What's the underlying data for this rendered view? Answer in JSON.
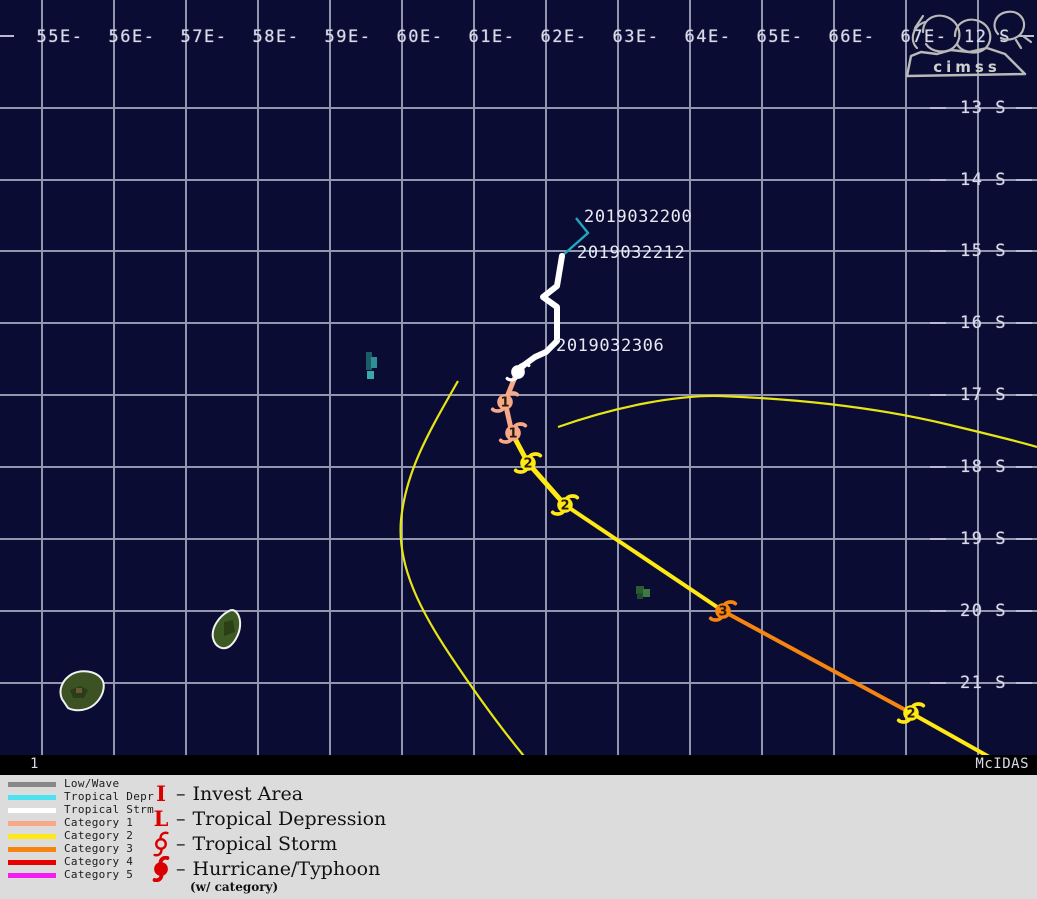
{
  "map": {
    "background_color": "#0b0c33",
    "grid_color": "#9397ad",
    "lon_labels": [
      "55E-",
      "56E-",
      "57E-",
      "58E-",
      "59E-",
      "60E-",
      "61E-",
      "62E-",
      "63E-",
      "64E-",
      "65E-",
      "66E-",
      "67E-"
    ],
    "lat_labels": [
      "13 S",
      "14 S",
      "15 S",
      "16 S",
      "17 S",
      "18 S",
      "19 S",
      "20 S",
      "21 S"
    ],
    "corner_lat_label": "12 S",
    "track_dates": [
      {
        "text": "2019032200"
      },
      {
        "text": "2019032212"
      },
      {
        "text": "2019032306"
      }
    ],
    "storm_points": [
      {
        "category": "TS",
        "label": "",
        "color": "#ffffff"
      },
      {
        "category": "1",
        "label": "1",
        "color": "#f7a887"
      },
      {
        "category": "1",
        "label": "1",
        "color": "#f7a887"
      },
      {
        "category": "2",
        "label": "2",
        "color": "#ffe914"
      },
      {
        "category": "2",
        "label": "2",
        "color": "#ffe914"
      },
      {
        "category": "3",
        "label": "3",
        "color": "#f58410"
      },
      {
        "category": "2",
        "label": "2",
        "color": "#ffe914"
      }
    ]
  },
  "status_bar": {
    "frame_number": "1",
    "source_label": "McIDAS"
  },
  "logo": {
    "name": "CIMSS",
    "text": "cimss"
  },
  "legend": {
    "lines": [
      {
        "label": "Low/Wave",
        "color": "#888888"
      },
      {
        "label": "Tropical Depr",
        "color": "#4ee2f0"
      },
      {
        "label": "Tropical Strm",
        "color": "#ffffff"
      },
      {
        "label": "Category 1",
        "color": "#f7a887"
      },
      {
        "label": "Category 2",
        "color": "#ffe914"
      },
      {
        "label": "Category 3",
        "color": "#f58410"
      },
      {
        "label": "Category 4",
        "color": "#e80000"
      },
      {
        "label": "Category 5",
        "color": "#f41cf4"
      }
    ],
    "symbols": [
      {
        "glyph": "I",
        "dash": "–",
        "label": "Invest Area"
      },
      {
        "glyph": "L",
        "dash": "–",
        "label": "Tropical Depression"
      },
      {
        "glyph": "TS",
        "dash": "–",
        "label": "Tropical Storm"
      },
      {
        "glyph": "HU",
        "dash": "–",
        "label": "Hurricane/Typhoon"
      }
    ],
    "note": "(w/ category)",
    "symbol_color": "#d90000",
    "background_color": "#dcdcdc"
  }
}
